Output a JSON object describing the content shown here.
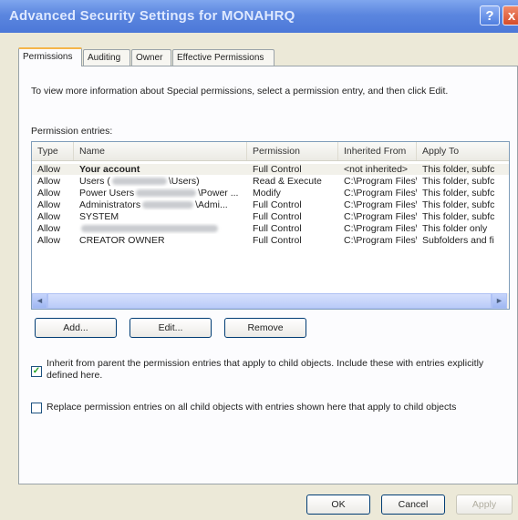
{
  "window": {
    "title": "Advanced Security Settings for MONAHRQ",
    "help_glyph": "?",
    "close_glyph": "x"
  },
  "tabs": [
    {
      "label": "Permissions"
    },
    {
      "label": "Auditing"
    },
    {
      "label": "Owner"
    },
    {
      "label": "Effective Permissions"
    }
  ],
  "description": "To view more information about Special permissions, select a permission entry, and then click Edit.",
  "entries_label": "Permission entries:",
  "columns": [
    "Type",
    "Name",
    "Permission",
    "Inherited From",
    "Apply To"
  ],
  "rows": [
    {
      "type": "Allow",
      "name": "Your account",
      "permission": "Full Control",
      "inherited": "<not inherited>",
      "apply": "This folder, subfc"
    },
    {
      "type": "Allow",
      "name": "Users (",
      "name_suffix": "\\Users)",
      "permission": "Read & Execute",
      "inherited": "C:\\Program Files\\",
      "apply": "This folder, subfc"
    },
    {
      "type": "Allow",
      "name": "Power Users",
      "name_suffix": "\\Power ...",
      "permission": "Modify",
      "inherited": "C:\\Program Files\\",
      "apply": "This folder, subfc"
    },
    {
      "type": "Allow",
      "name": "Administrators",
      "name_suffix": "\\Admi...",
      "permission": "Full Control",
      "inherited": "C:\\Program Files\\",
      "apply": "This folder, subfc"
    },
    {
      "type": "Allow",
      "name": "SYSTEM",
      "permission": "Full Control",
      "inherited": "C:\\Program Files\\",
      "apply": "This folder, subfc"
    },
    {
      "type": "Allow",
      "name": "",
      "permission": "Full Control",
      "inherited": "C:\\Program Files\\",
      "apply": "This folder only"
    },
    {
      "type": "Allow",
      "name": "CREATOR OWNER",
      "permission": "Full Control",
      "inherited": "C:\\Program Files\\",
      "apply": "Subfolders and fi"
    }
  ],
  "scroll": {
    "left_glyph": "◄",
    "right_glyph": "►"
  },
  "buttons": {
    "add": "Add...",
    "edit": "Edit...",
    "remove": "Remove",
    "ok": "OK",
    "cancel": "Cancel",
    "apply": "Apply"
  },
  "inherit_checkbox": {
    "checked": true,
    "check_glyph": "✓",
    "line1": "Inherit from parent the permission entries that apply to child objects. Include these with entries explicitly",
    "line2": "defined here."
  },
  "replace_checkbox": {
    "checked": false,
    "label": "Replace permission entries on all child objects with entries shown here that apply to child objects"
  },
  "colors": {
    "title_bar": "#5b86df",
    "face": "#ece9d8",
    "active_tab_accent": "#f5b54a"
  }
}
